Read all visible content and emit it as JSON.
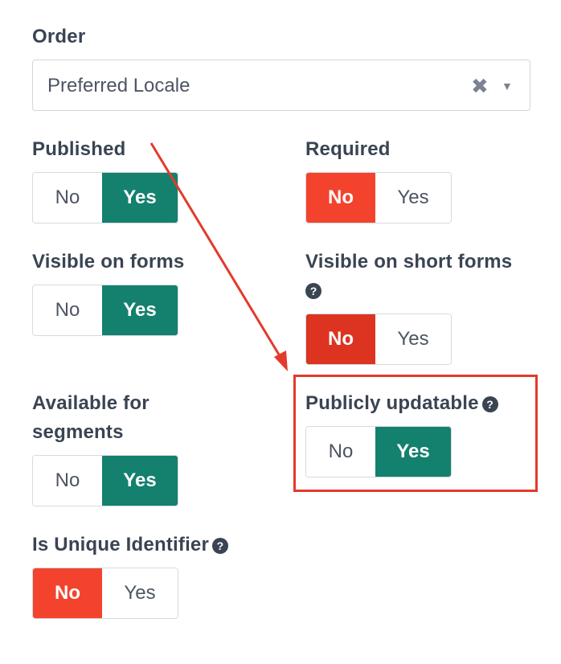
{
  "order": {
    "label": "Order",
    "value": "Preferred Locale",
    "clear_symbol": "✖",
    "caret_symbol": "▼"
  },
  "fields": {
    "published": {
      "label": "Published",
      "no": "No",
      "yes": "Yes",
      "selected": "Yes"
    },
    "required": {
      "label": "Required",
      "no": "No",
      "yes": "Yes",
      "selected": "No"
    },
    "visible_forms": {
      "label": "Visible on forms",
      "no": "No",
      "yes": "Yes",
      "selected": "Yes"
    },
    "visible_short_forms": {
      "label": "Visible on short forms",
      "no": "No",
      "yes": "Yes",
      "selected": "No"
    },
    "available_segments": {
      "label_line1": "Available for",
      "label_line2": "segments",
      "no": "No",
      "yes": "Yes",
      "selected": "Yes"
    },
    "publicly_updatable": {
      "label": "Publicly updatable",
      "no": "No",
      "yes": "Yes",
      "selected": "Yes"
    },
    "unique_identifier": {
      "label": "Is Unique Identifier",
      "no": "No",
      "yes": "Yes",
      "selected": "No"
    }
  },
  "help_symbol": "?",
  "colors": {
    "selected_yes": "#14806e",
    "selected_no": "#f4432c",
    "annotation": "#e33a2c"
  }
}
